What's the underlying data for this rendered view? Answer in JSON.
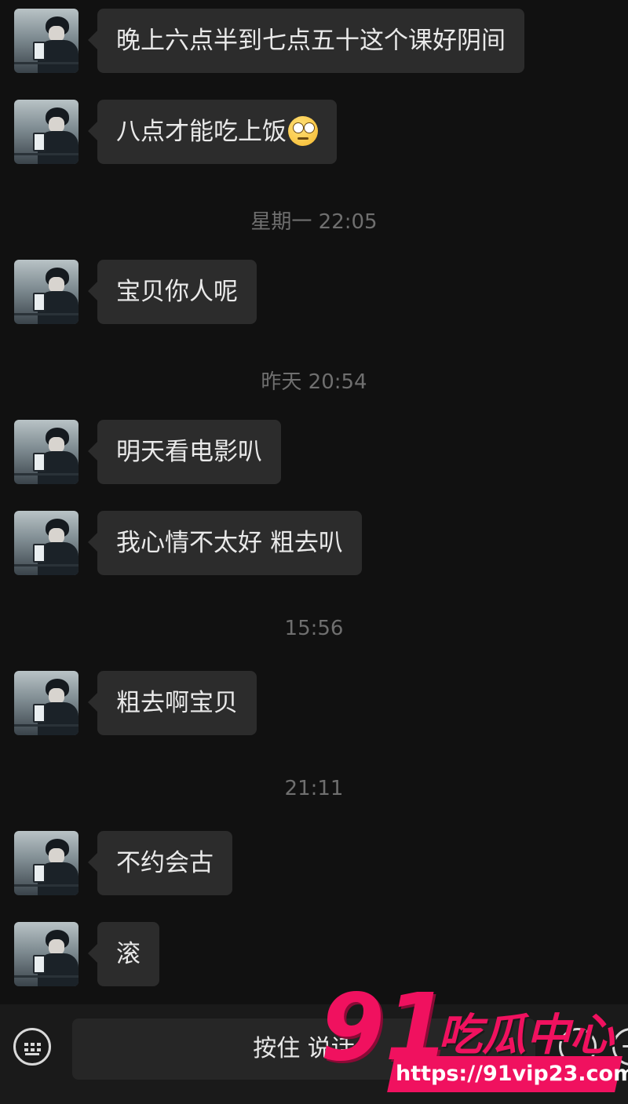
{
  "messages": [
    {
      "text": "晚上六点半到七点五十这个课好阴间"
    },
    {
      "text": "八点才能吃上饭",
      "emoji": "rolling-eyes-emoji"
    },
    {
      "text": "宝贝你人呢"
    },
    {
      "text": "明天看电影叭"
    },
    {
      "text": "我心情不太好 粗去叭"
    },
    {
      "text": "粗去啊宝贝"
    },
    {
      "text": "不约会古"
    },
    {
      "text": "滚"
    }
  ],
  "timestamps": [
    "星期一 22:05",
    "昨天 20:54",
    "15:56",
    "21:11"
  ],
  "input_bar": {
    "hold_to_talk": "按住 说话",
    "plus_label": "+"
  },
  "watermark": {
    "number": "91",
    "name": "吃瓜中心",
    "url": "https://91vip23.com"
  },
  "colors": {
    "background": "#111111",
    "bubble": "#2c2c2c",
    "timestamp": "#6f6f6f",
    "watermark": "#f0115f"
  }
}
